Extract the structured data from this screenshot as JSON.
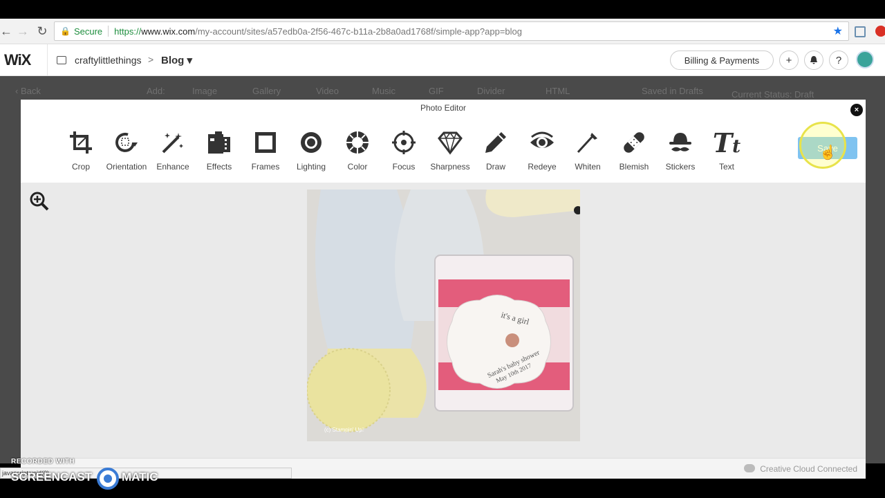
{
  "browser": {
    "secure_label": "Secure",
    "url_scheme": "https://",
    "url_host": "www.wix.com",
    "url_path": "/my-account/sites/a57edb0a-2f56-467c-b11a-2b8a0ad1768f/simple-app?app=blog"
  },
  "wix": {
    "logo": "WiX",
    "site_name": "craftylittlethings",
    "crumb_sep": ">",
    "section": "Blog ▾",
    "billing_label": "Billing & Payments",
    "add_icon": "plus-icon",
    "notif_icon": "bell-icon",
    "help_label": "?"
  },
  "background_editor": {
    "back": "‹ Back",
    "add": "Add:",
    "items": [
      "Image",
      "Gallery",
      "Video",
      "Music",
      "GIF",
      "Divider",
      "HTML"
    ],
    "saved": "Saved in Drafts",
    "status": "Current Status: Draft"
  },
  "editor": {
    "title": "Photo Editor",
    "close_label": "×",
    "save_label": "Save",
    "tools": [
      {
        "label": "Crop",
        "icon": "crop-icon"
      },
      {
        "label": "Orientation",
        "icon": "rotate-icon"
      },
      {
        "label": "Enhance",
        "icon": "magic-wand-icon"
      },
      {
        "label": "Effects",
        "icon": "film-icon"
      },
      {
        "label": "Frames",
        "icon": "frame-icon"
      },
      {
        "label": "Lighting",
        "icon": "sun-icon"
      },
      {
        "label": "Color",
        "icon": "color-wheel-icon"
      },
      {
        "label": "Focus",
        "icon": "crosshair-icon"
      },
      {
        "label": "Sharpness",
        "icon": "diamond-icon"
      },
      {
        "label": "Draw",
        "icon": "pencil-icon"
      },
      {
        "label": "Redeye",
        "icon": "eye-icon"
      },
      {
        "label": "Whiten",
        "icon": "brush-icon"
      },
      {
        "label": "Blemish",
        "icon": "bandage-icon"
      },
      {
        "label": "Stickers",
        "icon": "hat-mustache-icon"
      },
      {
        "label": "Text",
        "icon": "text-icon"
      }
    ],
    "photo": {
      "label_top": "it's a girl",
      "label_bottom": "Sarah's baby shower",
      "label_date": "May 10th 2017",
      "watermark": "(c) Stampin' Up!"
    },
    "footer_text": "Creative Cloud Connected"
  },
  "status_bar": "javascript:void(0)",
  "watermark": {
    "recorded": "RECORDED WITH",
    "brand_a": "SCREENCAST",
    "brand_b": "MATIC"
  }
}
